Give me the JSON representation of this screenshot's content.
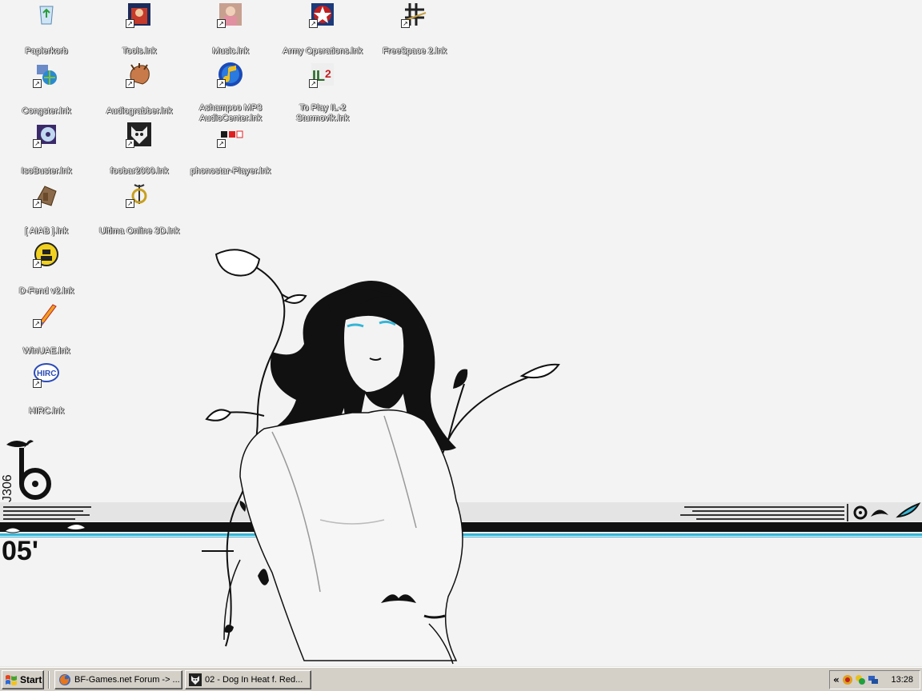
{
  "desktop": {
    "icons": [
      {
        "label": "Papierkorb",
        "icon": "recycle-bin-icon",
        "shortcut": false
      },
      {
        "label": "Tools.lnk",
        "icon": "tools-icon",
        "shortcut": true
      },
      {
        "label": "Music.lnk",
        "icon": "music-icon",
        "shortcut": true
      },
      {
        "label": "Army Operations.lnk",
        "icon": "army-operations-icon",
        "shortcut": true
      },
      {
        "label": "FreeSpace 2.lnk",
        "icon": "freespace-icon",
        "shortcut": true
      },
      {
        "label": "Congster.lnk",
        "icon": "congster-icon",
        "shortcut": true
      },
      {
        "label": "Audiograbber.lnk",
        "icon": "audiograbber-icon",
        "shortcut": true
      },
      {
        "label": "Ashampoo MP3 AudioCenter.lnk",
        "icon": "ashampoo-icon",
        "shortcut": true
      },
      {
        "label": "To Play IL-2 Sturmovik.lnk",
        "icon": "il2-icon",
        "shortcut": true
      },
      {
        "label": "IsoBuster.lnk",
        "icon": "isobuster-icon",
        "shortcut": true
      },
      {
        "label": "foobar2000.lnk",
        "icon": "foobar-icon",
        "shortcut": true
      },
      {
        "label": "phonostar-Player.lnk",
        "icon": "phonostar-icon",
        "shortcut": true
      },
      {
        "label": "[ AIAB ].lnk",
        "icon": "aiab-icon",
        "shortcut": true
      },
      {
        "label": "Ultima Online 3D.lnk",
        "icon": "ultima-icon",
        "shortcut": true
      },
      {
        "label": "D-Fend v2.lnk",
        "icon": "dfend-icon",
        "shortcut": true
      },
      {
        "label": "WinUAE.lnk",
        "icon": "winuae-icon",
        "shortcut": true
      },
      {
        "label": "HIRC.lnk",
        "icon": "hirc-icon",
        "shortcut": true
      }
    ],
    "wallpaper": {
      "logo_text": "J306",
      "number_text": "05'"
    }
  },
  "taskbar": {
    "start_label": "Start",
    "tasks": [
      {
        "label": "BF-Games.net Forum -> ...",
        "icon": "firefox-icon"
      },
      {
        "label": "02 - Dog In Heat f. Red...",
        "icon": "foobar-icon"
      }
    ],
    "tray_chevron": "«",
    "clock": "13:28"
  },
  "colors": {
    "taskbar": "#d4d0c8",
    "wallpaper_bg": "#f3f3f3",
    "stripe_black": "#111111",
    "stripe_cyan": "#35b6d6"
  }
}
